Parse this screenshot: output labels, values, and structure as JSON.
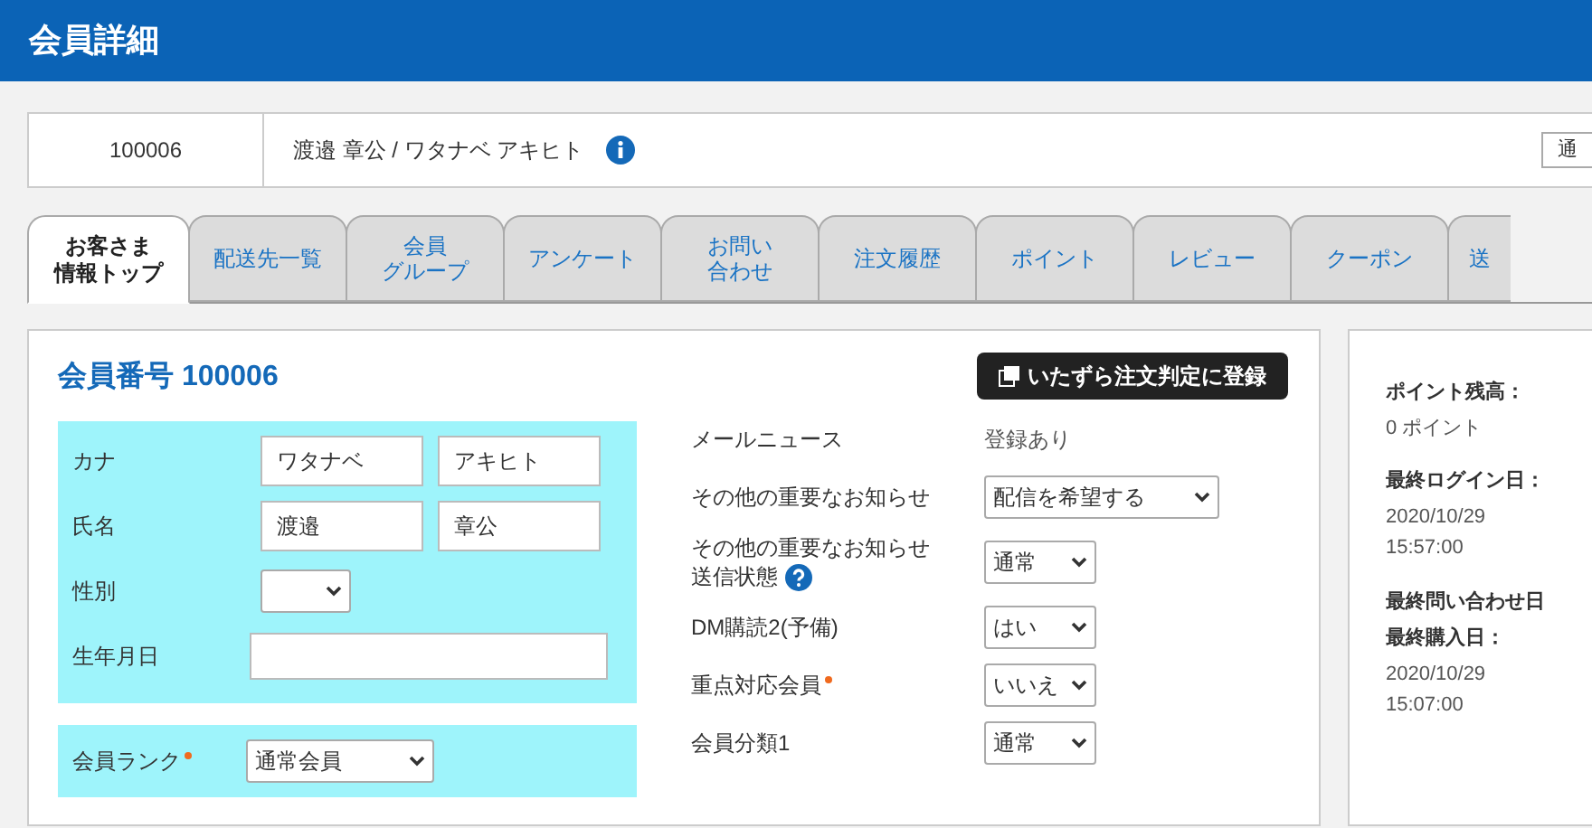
{
  "header": {
    "title": "会員詳細"
  },
  "member_bar": {
    "id": "100006",
    "name": "渡邉 章公 / ワタナベ アキヒト",
    "status_select": "通"
  },
  "tabs": [
    {
      "lines": [
        "お客さま",
        "情報トップ"
      ],
      "selected": true
    },
    {
      "lines": [
        "配送先一覧"
      ],
      "selected": false
    },
    {
      "lines": [
        "会員",
        "グループ"
      ],
      "selected": false
    },
    {
      "lines": [
        "アンケート"
      ],
      "selected": false
    },
    {
      "lines": [
        "お問い",
        "合わせ"
      ],
      "selected": false
    },
    {
      "lines": [
        "注文履歴"
      ],
      "selected": false
    },
    {
      "lines": [
        "ポイント"
      ],
      "selected": false
    },
    {
      "lines": [
        "レビュー"
      ],
      "selected": false
    },
    {
      "lines": [
        "クーポン"
      ],
      "selected": false
    },
    {
      "lines": [
        "送"
      ],
      "selected": false
    }
  ],
  "member_panel": {
    "heading": "会員番号 100006",
    "register_button": "いたずら注文判定に登録",
    "personal_fields": [
      {
        "label": "カナ",
        "kind": "pair",
        "values": [
          "ワタナベ",
          "アキヒト"
        ]
      },
      {
        "label": "氏名",
        "kind": "pair",
        "values": [
          "渡邉",
          "章公"
        ]
      },
      {
        "label": "性別",
        "kind": "select"
      },
      {
        "label": "生年月日",
        "kind": "text"
      }
    ],
    "rank": {
      "label": "会員ランク",
      "required": true,
      "value": "通常会員"
    },
    "settings": [
      {
        "label_lines": [
          "メールニュース"
        ],
        "kind": "static",
        "value": "登録あり",
        "required": false,
        "help": false
      },
      {
        "label_lines": [
          "その他の重要なお知らせ"
        ],
        "kind": "select",
        "value": "配信を希望する",
        "required": false,
        "help": false
      },
      {
        "label_lines": [
          "その他の重要なお知らせ",
          "送信状態"
        ],
        "kind": "select",
        "value": "通常",
        "required": false,
        "help": true
      },
      {
        "label_lines": [
          "DM購読2(予備)"
        ],
        "kind": "select",
        "value": "はい",
        "required": false,
        "help": false
      },
      {
        "label_lines": [
          "重点対応会員"
        ],
        "kind": "select",
        "value": "いいえ",
        "required": true,
        "help": false
      },
      {
        "label_lines": [
          "会員分類1"
        ],
        "kind": "select",
        "value": "通常",
        "required": false,
        "help": false
      }
    ]
  },
  "side_panel": {
    "items": [
      {
        "label": "ポイント残高：",
        "value": "0 ポイント"
      },
      {
        "label": "最終ログイン日：",
        "value": "2020/10/29\n15:57:00"
      },
      {
        "label": "最終問い合わせ日"
      },
      {
        "label": "最終購入日：",
        "value": "2020/10/29\n15:07:00"
      }
    ]
  }
}
